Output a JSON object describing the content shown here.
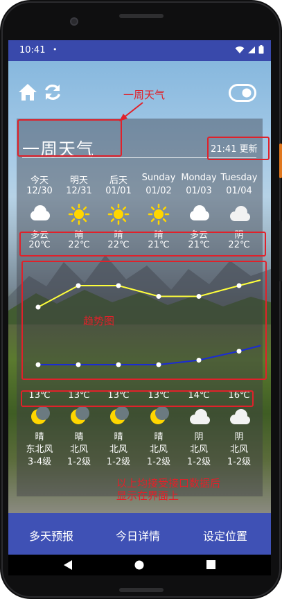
{
  "status_bar": {
    "time": "10:41",
    "dot": "•"
  },
  "toolbar": {
    "home_icon": "home-icon",
    "refresh_icon": "refresh-icon",
    "toggle_icon": "toggle-icon"
  },
  "card": {
    "title": "一周天气",
    "update_time": "21:41 更新"
  },
  "days": [
    {
      "name": "今天",
      "date": "12/30",
      "day_weather": "多云",
      "day_icon": "cloudy-icon",
      "high": "20℃",
      "low": "13℃",
      "night_icon": "moon-icon",
      "night_weather": "晴",
      "wind_dir": "东北风",
      "wind_level": "3-4级"
    },
    {
      "name": "明天",
      "date": "12/31",
      "day_weather": "晴",
      "day_icon": "sun-icon",
      "high": "22℃",
      "low": "13℃",
      "night_icon": "moon-icon",
      "night_weather": "晴",
      "wind_dir": "北风",
      "wind_level": "1-2级"
    },
    {
      "name": "后天",
      "date": "01/01",
      "day_weather": "晴",
      "day_icon": "sun-icon",
      "high": "22℃",
      "low": "13℃",
      "night_icon": "moon-icon",
      "night_weather": "晴",
      "wind_dir": "北风",
      "wind_level": "1-2级"
    },
    {
      "name": "Sunday",
      "date": "01/02",
      "day_weather": "晴",
      "day_icon": "sun-icon",
      "high": "21℃",
      "low": "13℃",
      "night_icon": "moon-icon",
      "night_weather": "晴",
      "wind_dir": "北风",
      "wind_level": "1-2级"
    },
    {
      "name": "Monday",
      "date": "01/03",
      "day_weather": "多云",
      "day_icon": "cloudy-icon",
      "high": "21℃",
      "low": "14℃",
      "night_icon": "cloud-icon",
      "night_weather": "阴",
      "wind_dir": "北风",
      "wind_level": "1-2级"
    },
    {
      "name": "Tuesday",
      "date": "01/04",
      "day_weather": "阴",
      "day_icon": "cloud-icon",
      "high": "22℃",
      "low": "16℃",
      "night_icon": "cloud-icon",
      "night_weather": "阴",
      "wind_dir": "北风",
      "wind_level": "1-2级"
    }
  ],
  "annotations": {
    "title_note": "一周天气",
    "trend_note": "趋势图",
    "bottom_note_line1": "以上均接受接口数据后",
    "bottom_note_line2": "显示在界面上"
  },
  "chart_data": {
    "type": "line",
    "categories": [
      "今天",
      "明天",
      "后天",
      "Sunday",
      "Monday",
      "Tuesday"
    ],
    "series": [
      {
        "values": [
          20,
          22,
          22,
          21,
          21,
          22
        ],
        "color": "#ffff3b"
      },
      {
        "values": [
          13,
          13,
          13,
          13,
          14,
          16
        ],
        "color": "#1a2bd6"
      }
    ],
    "point_color": "#ffffff"
  },
  "navbar": {
    "items": [
      "多天预报",
      "今日详情",
      "设定位置"
    ]
  },
  "colors": {
    "accent": "#3f51b5",
    "annotation": "#e0212a",
    "high_line": "#ffff3b",
    "low_line": "#1a2bd6"
  }
}
